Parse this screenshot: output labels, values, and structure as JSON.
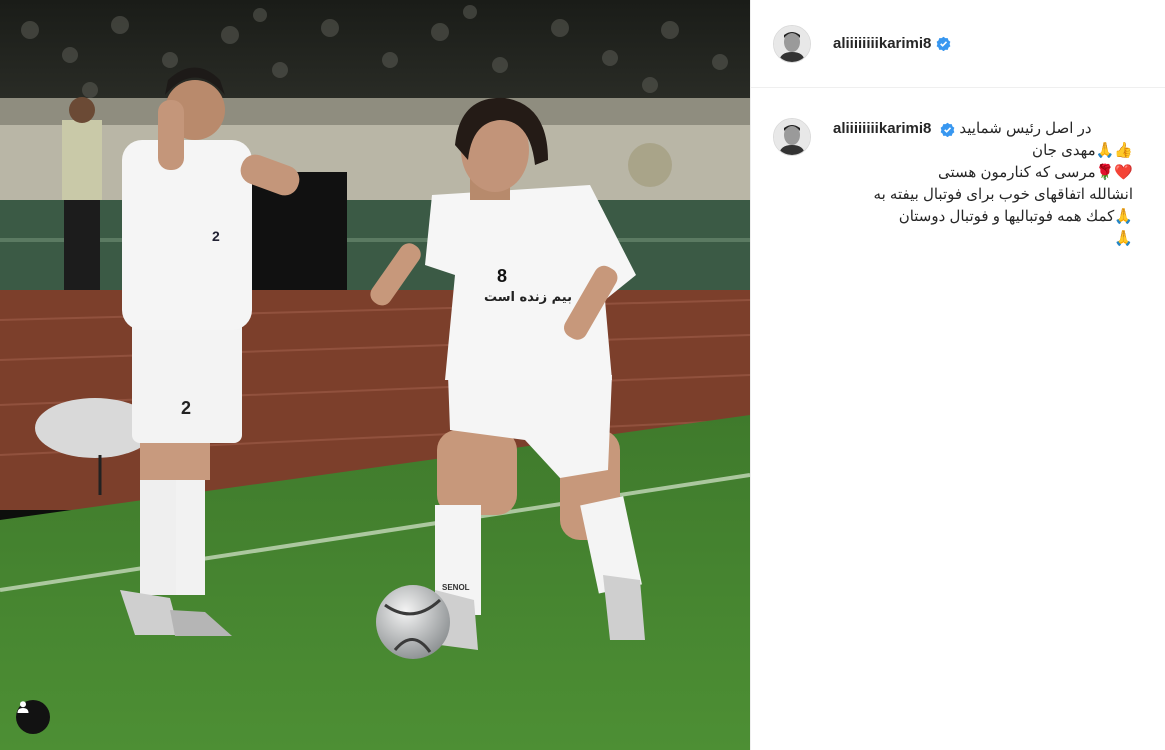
{
  "post": {
    "username": "aliiiiiiiikarimi8",
    "verified": true
  },
  "caption": {
    "line1": "در اصل رئیس شمایید",
    "line2": "👍🙏مهدی جان",
    "line3": "❤️🌹مرسی که کنارمون هستی",
    "line4": "انشالله اتفاقهای خوب برای فوتبال بیفته به",
    "line5": "🙏کمك همه فوتبالیها و فوتبال دوستان",
    "line6": "🙏"
  },
  "photo": {
    "jersey_numbers": [
      "2",
      "8",
      "2"
    ],
    "jersey_text": "بیم زنده است",
    "ball_brand": "SENOL"
  },
  "icons": {
    "user_tag": "user-tag-icon",
    "verified": "verified-badge-icon"
  },
  "colors": {
    "verified_blue": "#3897f0",
    "divider": "#efefef",
    "text": "#262626"
  }
}
